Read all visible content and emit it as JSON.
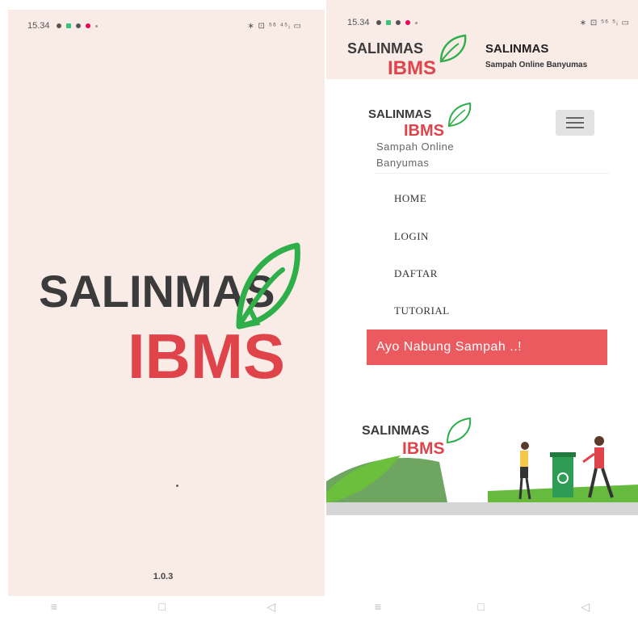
{
  "left_screen": {
    "status_time": "15.34",
    "status_right": "∗ ⊡ ⁵⁶ ⁴⁵ᵢ ▭",
    "logo": {
      "salinmas": "SALINMAS",
      "ibms": "IBMS"
    },
    "version": "1.0.3"
  },
  "right_screen": {
    "status_time": "15.34",
    "status_right": "∗ ⊡ ⁵⁶ ⁵ᵢ ▭",
    "header": {
      "logo": {
        "salinmas": "SALINMAS",
        "ibms": "IBMS"
      },
      "title": "SALINMAS",
      "subtitle": "Sampah Online Banyumas"
    },
    "nav_card": {
      "logo": {
        "salinmas": "SALINMAS",
        "ibms": "IBMS"
      },
      "tagline_line1": "Sampah Online",
      "tagline_line2": "Banyumas"
    },
    "menu": [
      "HOME",
      "LOGIN",
      "DAFTAR",
      "TUTORIAL"
    ],
    "cta_label": "Ayo Nabung Sampah ..!",
    "banner_logo": {
      "salinmas": "SALINMAS",
      "ibms": "IBMS"
    }
  },
  "nav_bar_icons": [
    "menu-icon",
    "square-icon",
    "back-icon"
  ],
  "colors": {
    "brand_red": "#e0444b",
    "brand_green": "#2eaf4a",
    "splash_bg": "#f9ebe6",
    "cta": "#ea5a5e"
  }
}
